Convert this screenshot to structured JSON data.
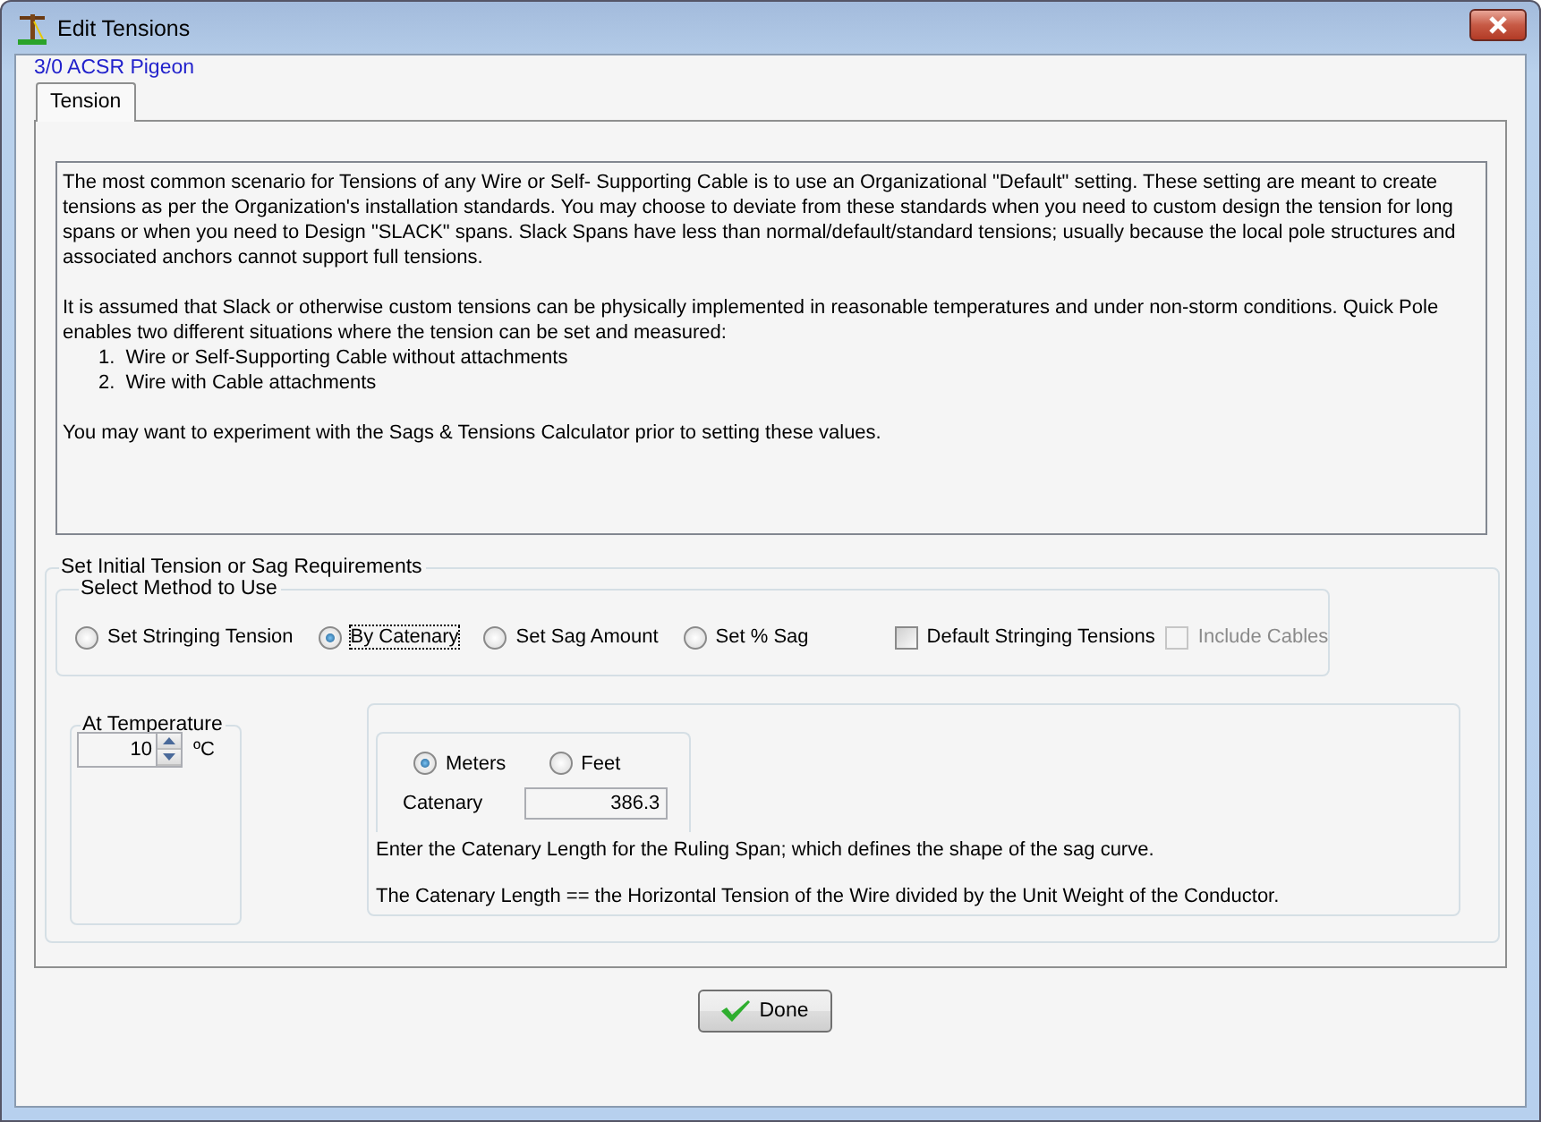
{
  "window": {
    "title": "Edit Tensions"
  },
  "subtitle": "3/0 ACSR Pigeon",
  "tabs": [
    {
      "label": "Tension",
      "selected": true
    }
  ],
  "description": {
    "paragraphs": [
      "The most common scenario for Tensions of any Wire or Self- Supporting Cable is to use an Organizational \"Default\" setting. These setting are meant to create tensions as per the Organization's installation standards. You may choose to deviate from these standards when you need to custom design the tension for long spans or when you need to Design \"SLACK\" spans. Slack Spans have less than normal/default/standard tensions; usually because the local pole structures and associated anchors cannot support full tensions.",
      "It is assumed that Slack or otherwise custom tensions can be physically implemented in reasonable temperatures and under non-storm conditions. Quick Pole enables two different situations where the tension can be set and measured:"
    ],
    "steps": [
      {
        "number": "1.",
        "text": "Wire or Self-Supporting Cable without attachments"
      },
      {
        "number": "2.",
        "text": "Wire with Cable attachments"
      }
    ],
    "closing": "You may want to experiment with the Sags & Tensions Calculator prior to setting these values."
  },
  "requirements": {
    "title": "Set Initial Tension or Sag Requirements",
    "method": {
      "title": "Select Method to Use",
      "options": [
        {
          "label": "Set Stringing Tension",
          "selected": false,
          "focused": false
        },
        {
          "label": "By Catenary",
          "selected": true,
          "focused": true
        },
        {
          "label": "Set Sag Amount",
          "selected": false,
          "focused": false
        },
        {
          "label": "Set % Sag",
          "selected": false,
          "focused": false
        }
      ],
      "checkboxes": [
        {
          "label": "Default Stringing Tensions",
          "checked": false,
          "disabled": false
        },
        {
          "label": "Include Cables",
          "checked": false,
          "disabled": true
        }
      ]
    },
    "temperature": {
      "title": "At Temperature",
      "value": "10",
      "unit": "ºC"
    },
    "catenary": {
      "units": [
        {
          "label": "Meters",
          "selected": true
        },
        {
          "label": "Feet",
          "selected": false
        }
      ],
      "label": "Catenary",
      "value": "386.3",
      "hint": "Enter the Catenary Length for the Ruling Span; which defines the shape of the sag curve.",
      "note": "The Catenary Length == the Horizontal Tension of the Wire divided by the Unit Weight of the Conductor."
    }
  },
  "buttons": [
    {
      "label": "Done"
    }
  ]
}
